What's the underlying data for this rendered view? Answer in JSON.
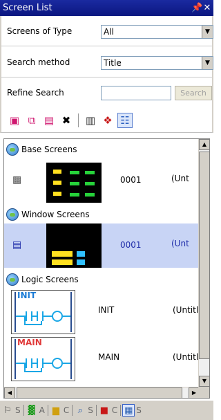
{
  "window": {
    "title": "Screen List",
    "pin_glyph": "↕",
    "close_glyph": "✕"
  },
  "filters": {
    "screens_of_type_label": "Screens of Type",
    "screens_of_type_value": "All",
    "search_method_label": "Search method",
    "search_method_value": "Title",
    "refine_search_label": "Refine Search",
    "refine_search_value": "",
    "search_button": "Search"
  },
  "toolbar": {
    "buttons": [
      {
        "name": "new-screen-icon",
        "glyph": "▣",
        "color": "#d01870"
      },
      {
        "name": "copy-screen-icon",
        "glyph": "⧉",
        "color": "#d01870"
      },
      {
        "name": "paste-screen-icon",
        "glyph": "▤",
        "color": "#d01870"
      },
      {
        "name": "delete-icon",
        "glyph": "✖",
        "color": "#000000"
      },
      {
        "name": "monitor-icon",
        "glyph": "▥",
        "color": "#333333"
      },
      {
        "name": "palette-icon",
        "glyph": "❖",
        "color": "#c81818"
      },
      {
        "name": "screen-tree-icon",
        "glyph": "☷",
        "color": "#2b5fc0"
      }
    ]
  },
  "groups": {
    "base": {
      "label": "Base Screens",
      "number": "0001",
      "title": "(Unt"
    },
    "window": {
      "label": "Window Screens",
      "number": "0001",
      "title": "(Unt"
    },
    "logic": {
      "label": "Logic Screens",
      "items": [
        {
          "thumb_label": "INIT",
          "thumb_color": "#1a7bd6",
          "name": "INIT",
          "title": "(Untitled"
        },
        {
          "thumb_label": "MAIN",
          "thumb_color": "#e03a3a",
          "name": "MAIN",
          "title": "(Untitled"
        }
      ]
    }
  },
  "tabs": [
    {
      "letter": "S",
      "glyph": "⚐",
      "color": "#444444"
    },
    {
      "letter": "A",
      "glyph": "▓",
      "color": "#1a9a1a"
    },
    {
      "letter": "C",
      "glyph": "▆",
      "color": "#d0a010"
    },
    {
      "letter": "S",
      "glyph": "⌕",
      "color": "#2a5fb0"
    },
    {
      "letter": "C",
      "glyph": "■",
      "color": "#c81818"
    },
    {
      "letter": "S",
      "glyph": "▦",
      "color": "#2a5fb0"
    }
  ]
}
